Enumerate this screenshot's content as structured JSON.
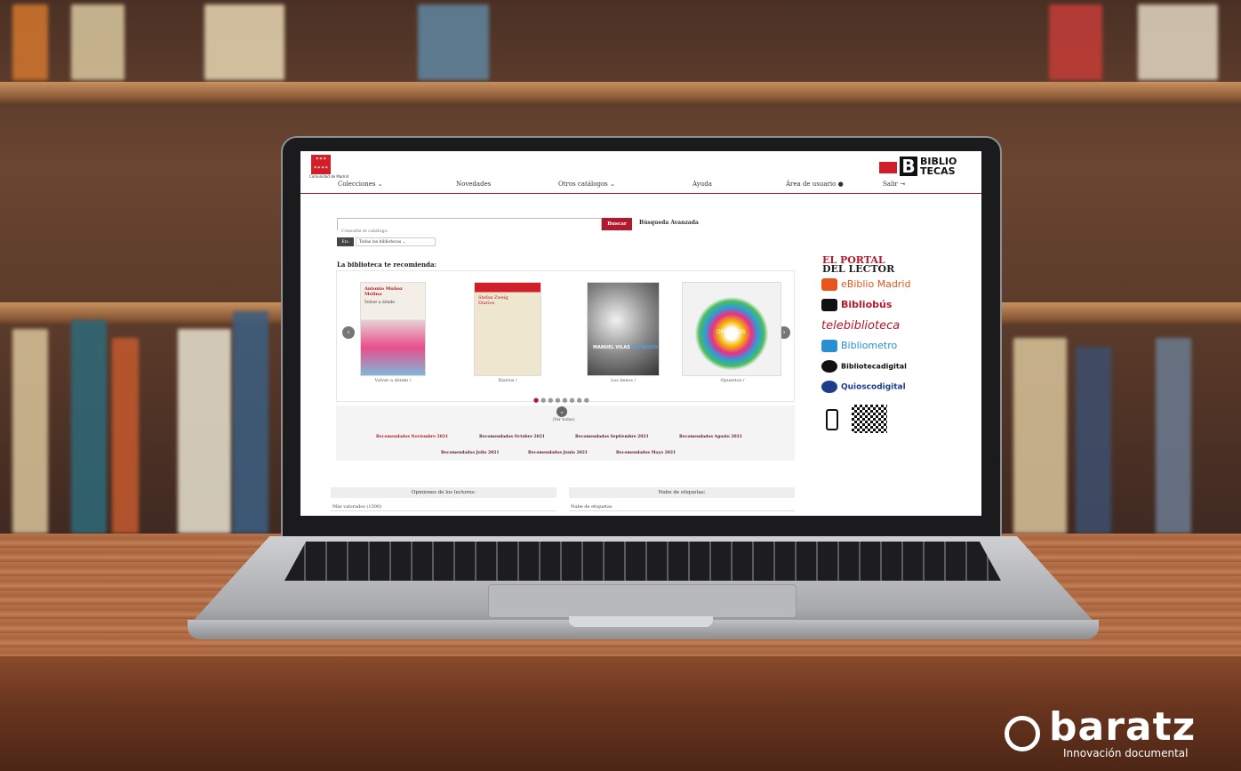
{
  "site": {
    "logo_subtext": "Comunidad de Madrid",
    "brand_text": "BIBLIO TECAS"
  },
  "nav": {
    "items": [
      "Colecciones ⌄",
      "Novedades",
      "Otros catálogos ⌄",
      "Ayuda",
      "Área de usuario",
      "Salir"
    ]
  },
  "search": {
    "placeholder": "Consulte el catálogo",
    "button": "Buscar",
    "advanced": "Búsqueda Avanzada",
    "scope_label": "En:",
    "scope_value": "Todas las bibliotecas"
  },
  "recommend": {
    "title": "La biblioteca te recomienda:",
    "books": [
      {
        "caption": "Volver a dónde /",
        "author": "Antonio Muñoz Molina",
        "subtitle": "Volver a dónde"
      },
      {
        "caption": "Diarios /",
        "author": "Stefan Zweig",
        "subtitle": "Diarios"
      },
      {
        "caption": "Los besos /",
        "author": "MANUEL VILAS",
        "subtitle": "LOS BESOS"
      },
      {
        "caption": "Opuestos /",
        "author": "",
        "subtitle": "OPUESTOS"
      }
    ],
    "see_all": "(Ver todas)",
    "lists": [
      "Recomendados Noviembre 2021",
      "Recomendados Octubre 2021",
      "Recomendados Septiembre 2021",
      "Recomendados Agosto 2021",
      "Recomendados Julio 2021",
      "Recomendados Junio 2021",
      "Recomendados Mayo 2021"
    ]
  },
  "panels": {
    "opinions_title": "Opiniones de los lectores:",
    "opinions_value": "Más valorados (1300)",
    "tags_title": "Nube de etiquetas:",
    "tags_value": "Nube de etiquetas"
  },
  "portal": {
    "title_line1": "EL PORTAL",
    "title_line2": "DEL LECTOR",
    "links": [
      {
        "label": "eBiblio Madrid",
        "color": "#e8551c"
      },
      {
        "label": "Bibliobús",
        "color": "#b3192c"
      },
      {
        "label": "telebiblioteca",
        "color": "#b3192c"
      },
      {
        "label": "Bibliometro",
        "color": "#2a8fd1"
      },
      {
        "label": "Bibliotecadigital",
        "color": "#111111"
      },
      {
        "label": "Quioscodigital",
        "color": "#1c3d8c"
      }
    ]
  },
  "watermark": {
    "brand": "baratz",
    "tagline": "Innovación documental"
  }
}
